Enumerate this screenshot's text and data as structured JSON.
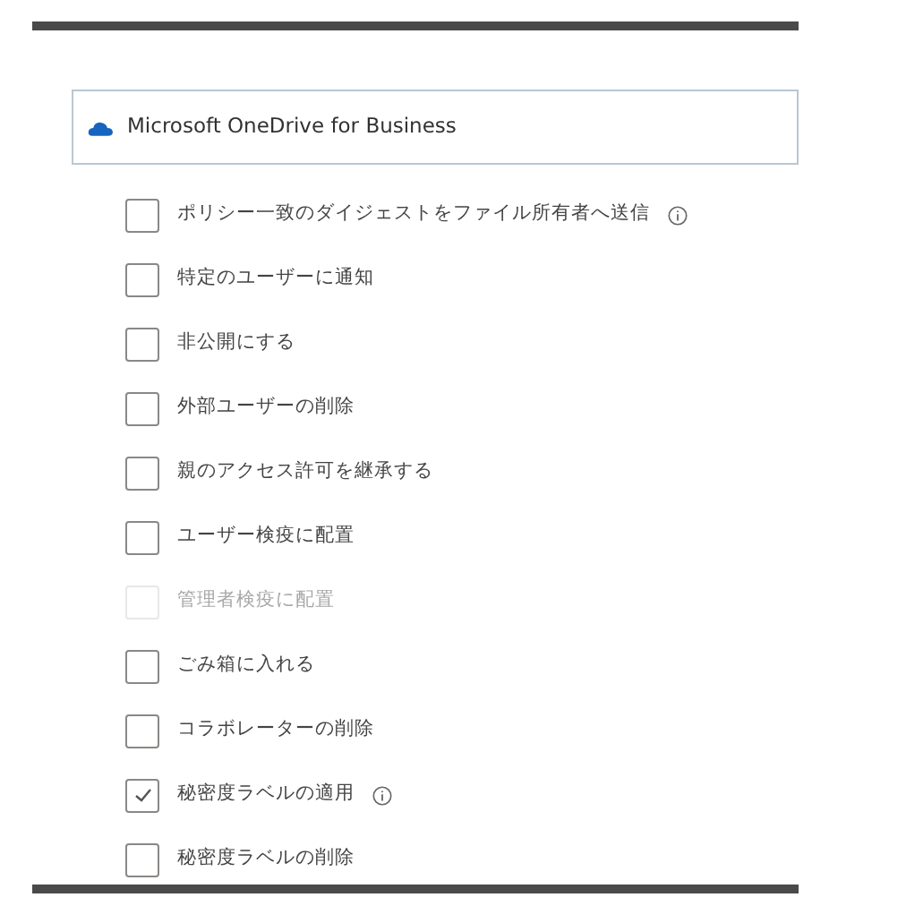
{
  "service": {
    "label": "Microsoft OneDrive for Business"
  },
  "actions": [
    {
      "label": "ポリシー一致のダイジェストをファイル所有者へ送信",
      "checked": false,
      "disabled": false,
      "info": true
    },
    {
      "label": "特定のユーザーに通知",
      "checked": false,
      "disabled": false,
      "info": false
    },
    {
      "label": "非公開にする",
      "checked": false,
      "disabled": false,
      "info": false
    },
    {
      "label": "外部ユーザーの削除",
      "checked": false,
      "disabled": false,
      "info": false
    },
    {
      "label": "親のアクセス許可を継承する",
      "checked": false,
      "disabled": false,
      "info": false
    },
    {
      "label": "ユーザー検疫に配置",
      "checked": false,
      "disabled": false,
      "info": false
    },
    {
      "label": "管理者検疫に配置",
      "checked": false,
      "disabled": true,
      "info": false
    },
    {
      "label": "ごみ箱に入れる",
      "checked": false,
      "disabled": false,
      "info": false
    },
    {
      "label": "コラボレーターの削除",
      "checked": false,
      "disabled": false,
      "info": false
    },
    {
      "label": "秘密度ラベルの適用",
      "checked": true,
      "disabled": false,
      "info": true
    },
    {
      "label": "秘密度ラベルの削除",
      "checked": false,
      "disabled": false,
      "info": false
    }
  ]
}
